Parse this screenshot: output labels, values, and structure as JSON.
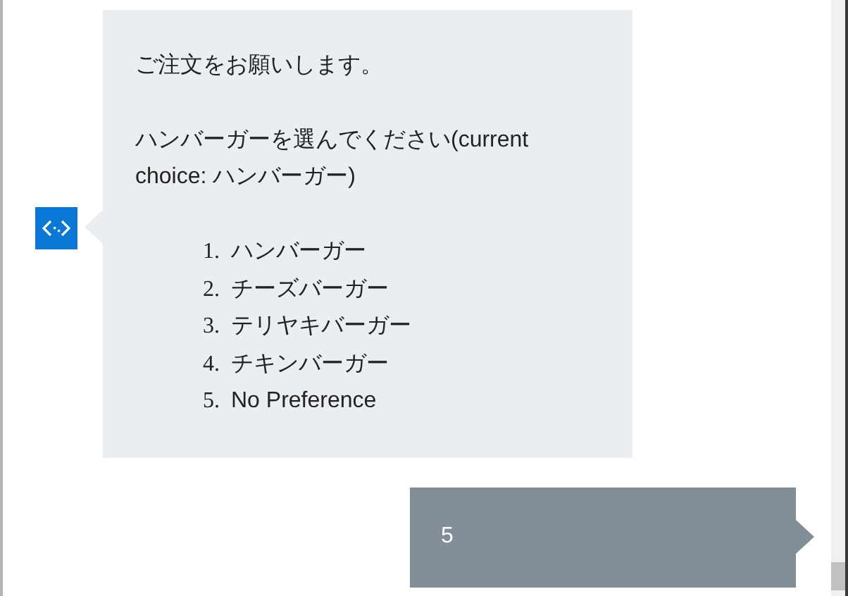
{
  "bot_message": {
    "greeting": "ご注文をお願いします。",
    "prompt": "ハンバーガーを選んでください(current choice: ハンバーガー)",
    "choices": [
      {
        "number": "1.",
        "label": "ハンバーガー"
      },
      {
        "number": "2.",
        "label": "チーズバーガー"
      },
      {
        "number": "3.",
        "label": "テリヤキバーガー"
      },
      {
        "number": "4.",
        "label": "チキンバーガー"
      },
      {
        "number": "5.",
        "label": "No Preference"
      }
    ]
  },
  "user_message": {
    "text": "5"
  }
}
